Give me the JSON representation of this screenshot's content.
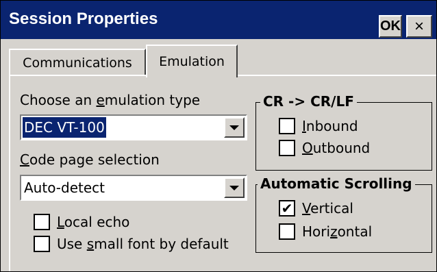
{
  "window": {
    "title": "Session Properties",
    "ok_label": "OK",
    "close_label": "×"
  },
  "tabs": [
    {
      "label": "Communications",
      "active": false
    },
    {
      "label": "Emulation",
      "active": true
    }
  ],
  "emulation": {
    "type_label_pre": "Choose an ",
    "type_label_ul": "e",
    "type_label_post": "mulation type",
    "type_value": "DEC VT-100",
    "codepage_label_ul": "C",
    "codepage_label_post": "ode page selection",
    "codepage_value": "Auto-detect"
  },
  "options": {
    "local_echo": {
      "ul": "L",
      "rest": "ocal echo",
      "checked": false
    },
    "small_font": {
      "pre": "Use ",
      "ul": "s",
      "rest": "mall font by default",
      "checked": false
    }
  },
  "crlf": {
    "title": "CR -> CR/LF",
    "inbound": {
      "ul": "I",
      "rest": "nbound",
      "checked": false
    },
    "outbound": {
      "ul": "O",
      "rest": "utbound",
      "checked": false
    }
  },
  "scrolling": {
    "title": "Automatic Scrolling",
    "vertical": {
      "ul": "V",
      "rest": "ertical",
      "checked": true
    },
    "horizontal": {
      "pre": "Hori",
      "ul": "z",
      "rest": "ontal",
      "checked": false
    }
  },
  "check_glyph": "✔"
}
